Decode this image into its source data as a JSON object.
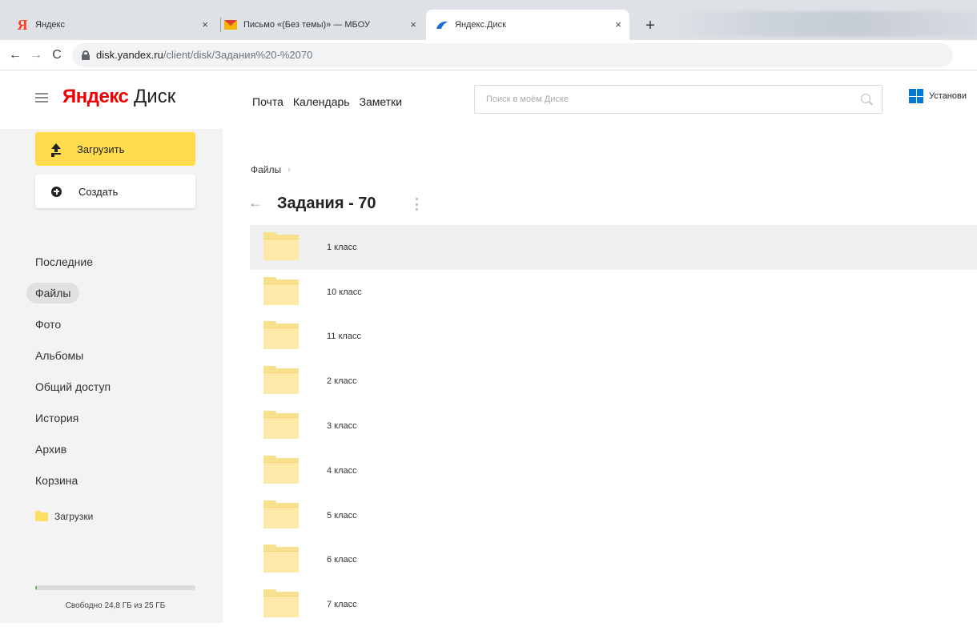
{
  "browser": {
    "tabs": [
      {
        "title": "Яндекс",
        "favicon": "yandex-ya-icon"
      },
      {
        "title": "Письмо «(Без темы)» — МБОУ",
        "favicon": "mail-envelope-icon"
      },
      {
        "title": "Яндекс.Диск",
        "favicon": "yandex-disk-icon"
      }
    ],
    "close_glyph": "×",
    "new_tab_glyph": "+",
    "url_host": "disk.yandex.ru",
    "url_path": "/client/disk/Задания%20-%2070"
  },
  "header": {
    "logo_brand": "Яндекс",
    "logo_product": "Диск",
    "service_links": [
      "Почта",
      "Календарь",
      "Заметки"
    ],
    "search_placeholder": "Поиск в моём Диске",
    "promo_text": "Установи"
  },
  "sidebar": {
    "upload_label": "Загрузить",
    "create_label": "Создать",
    "nav_items": [
      {
        "label": "Последние",
        "active": false
      },
      {
        "label": "Файлы",
        "active": true
      },
      {
        "label": "Фото",
        "active": false
      },
      {
        "label": "Альбомы",
        "active": false
      },
      {
        "label": "Общий доступ",
        "active": false
      },
      {
        "label": "История",
        "active": false
      },
      {
        "label": "Архив",
        "active": false
      },
      {
        "label": "Корзина",
        "active": false
      }
    ],
    "downloads_label": "Загрузки",
    "quota_text": "Свободно 24,8 ГБ из 25 ГБ",
    "quota_used_fraction": 0.008
  },
  "main": {
    "breadcrumb_root": "Файлы",
    "breadcrumb_chevron": "›",
    "back_glyph": "←",
    "title": "Задания - 70",
    "folders": [
      {
        "name": "1 класс",
        "selected": true
      },
      {
        "name": "10 класс",
        "selected": false
      },
      {
        "name": "11 класс",
        "selected": false
      },
      {
        "name": "2 класс",
        "selected": false
      },
      {
        "name": "3 класс",
        "selected": false
      },
      {
        "name": "4 класс",
        "selected": false
      },
      {
        "name": "5 класс",
        "selected": false
      },
      {
        "name": "6 класс",
        "selected": false
      },
      {
        "name": "7 класс",
        "selected": false
      }
    ]
  },
  "colors": {
    "upload_yellow": "#ffdb4d",
    "folder_yellow": "#ffe9a8",
    "yandex_red": "#ee0000",
    "sidebar_bg": "#f3f3f3"
  }
}
